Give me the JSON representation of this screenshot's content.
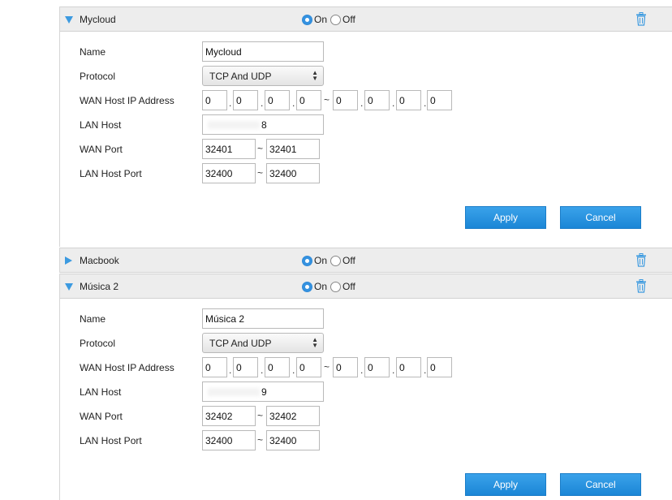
{
  "rules": [
    {
      "name": "Mycloud",
      "on_label": "On",
      "off_label": "Off",
      "enabled": true,
      "expanded": true,
      "fields": {
        "name_label": "Name",
        "name_value": "Mycloud",
        "protocol_label": "Protocol",
        "protocol_value": "TCP And UDP",
        "wan_ip_label": "WAN Host IP Address",
        "wan_ip_start": [
          "0",
          "0",
          "0",
          "0"
        ],
        "wan_ip_end": [
          "0",
          "0",
          "0",
          "0"
        ],
        "lan_host_label": "LAN Host",
        "lan_host_value": "8",
        "wan_port_label": "WAN Port",
        "wan_port_start": "32401",
        "wan_port_end": "32401",
        "lan_port_label": "LAN Host Port",
        "lan_port_start": "32400",
        "lan_port_end": "32400"
      },
      "apply_label": "Apply",
      "cancel_label": "Cancel"
    },
    {
      "name": "Macbook",
      "on_label": "On",
      "off_label": "Off",
      "enabled": true,
      "expanded": false
    },
    {
      "name": "Música 2",
      "on_label": "On",
      "off_label": "Off",
      "enabled": true,
      "expanded": true,
      "fields": {
        "name_label": "Name",
        "name_value": "Música 2",
        "protocol_label": "Protocol",
        "protocol_value": "TCP And UDP",
        "wan_ip_label": "WAN Host IP Address",
        "wan_ip_start": [
          "0",
          "0",
          "0",
          "0"
        ],
        "wan_ip_end": [
          "0",
          "0",
          "0",
          "0"
        ],
        "lan_host_label": "LAN Host",
        "lan_host_value": "9",
        "wan_port_label": "WAN Port",
        "wan_port_start": "32402",
        "wan_port_end": "32402",
        "lan_port_label": "LAN Host Port",
        "lan_port_start": "32400",
        "lan_port_end": "32400"
      },
      "apply_label": "Apply",
      "cancel_label": "Cancel"
    }
  ],
  "icons": {
    "expand": "caret-down-icon",
    "collapsed": "caret-right-icon",
    "delete": "trash-icon"
  },
  "colors": {
    "accent": "#3592e0",
    "header_bg": "#ededed",
    "button": "#2a95e0"
  }
}
